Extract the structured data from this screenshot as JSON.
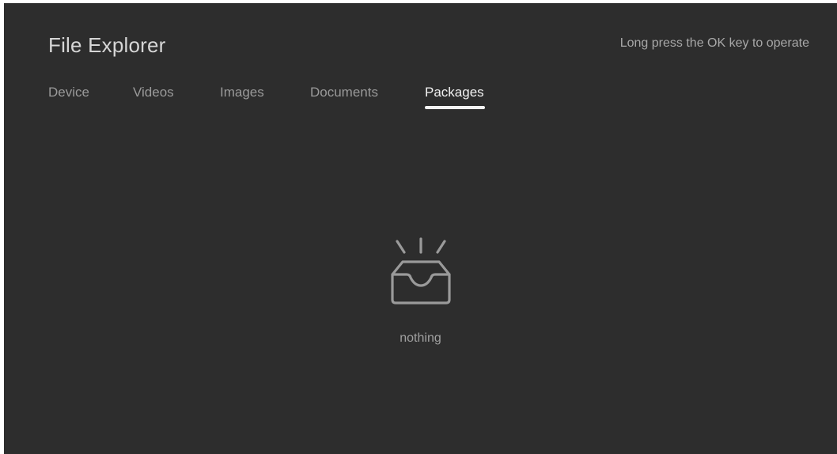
{
  "header": {
    "title": "File Explorer",
    "hint": "Long press the OK key to operate"
  },
  "tabs": [
    {
      "label": "Device",
      "active": false
    },
    {
      "label": "Videos",
      "active": false
    },
    {
      "label": "Images",
      "active": false
    },
    {
      "label": "Documents",
      "active": false
    },
    {
      "label": "Packages",
      "active": true
    }
  ],
  "empty_state": {
    "icon": "empty-inbox-icon",
    "message": "nothing"
  },
  "colors": {
    "background": "#2d2d2d",
    "active_tab": "#f2f2f2",
    "inactive_tab": "#9a9a9a",
    "icon_stroke": "#9a9a9a"
  }
}
